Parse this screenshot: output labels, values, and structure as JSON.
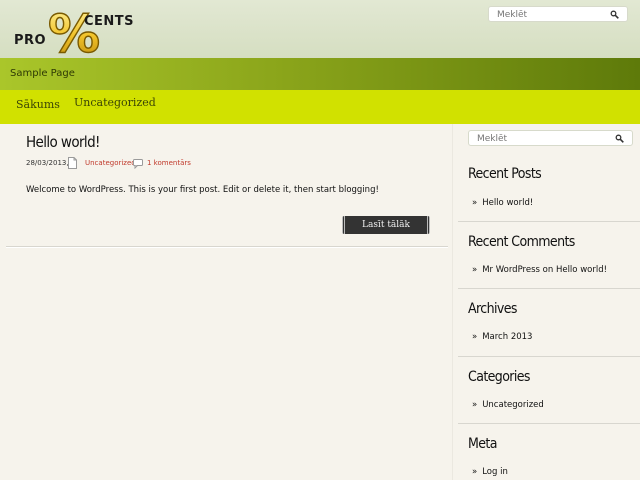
{
  "header": {
    "logo": {
      "pro": "PRO",
      "percent": "%",
      "cents": "CENTS"
    },
    "search_placeholder": "Meklēt"
  },
  "nav_top": {
    "link": "Sample Page"
  },
  "nav_main": {
    "items": [
      "Sākums",
      "Uncategorized"
    ]
  },
  "post": {
    "title": "Hello world!",
    "date": "28/03/2013,",
    "category": "Uncategorized",
    "comments": "1 komentārs",
    "body": "Welcome to WordPress. This is your first post. Edit or delete it, then start blogging!",
    "read_more": "Lasīt tālāk"
  },
  "sidebar": {
    "search_placeholder": "Meklēt",
    "recent_posts": {
      "title": "Recent Posts",
      "items": [
        "Hello world!"
      ]
    },
    "recent_comments": {
      "title": "Recent Comments",
      "author": "Mr WordPress",
      "on": "on",
      "post": "Hello world!"
    },
    "archives": {
      "title": "Archives",
      "items": [
        "March 2013"
      ]
    },
    "categories": {
      "title": "Categories",
      "items": [
        "Uncategorized"
      ]
    },
    "meta": {
      "title": "Meta",
      "items": [
        "Log in"
      ]
    }
  },
  "colors": {
    "accent_lime": "#d1e100",
    "nav_green": "#6b8a0f",
    "link_red": "#c0392b",
    "logo_gold": "#e8b51a"
  },
  "icons": [
    "search-icon",
    "document-icon",
    "comment-icon",
    "percent-logo-icon"
  ]
}
